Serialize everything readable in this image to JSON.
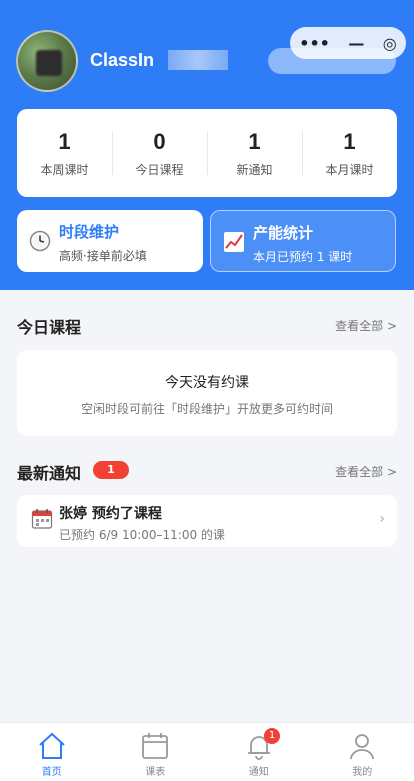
{
  "header": {
    "username": "ClassIn",
    "capsule": {
      "more_icon": "•••",
      "minimize_icon": "—",
      "close_icon": "◎"
    }
  },
  "stats": [
    {
      "value": "1",
      "label": "本周课时"
    },
    {
      "value": "0",
      "label": "今日课程"
    },
    {
      "value": "1",
      "label": "新通知"
    },
    {
      "value": "1",
      "label": "本月课时"
    }
  ],
  "cards": {
    "schedule": {
      "title": "时段维护",
      "subtitle": "高频·接单前必填",
      "icon": "clock-icon"
    },
    "stats": {
      "title": "产能统计",
      "subtitle": "本月已预约 1 课时",
      "icon": "chart-icon"
    }
  },
  "today": {
    "title": "今日课程",
    "view_all": "查看全部 >",
    "empty_title": "今天没有约课",
    "empty_hint": "空闲时段可前往「时段维护」开放更多可约时间"
  },
  "notices": {
    "title": "最新通知",
    "badge": "1",
    "view_all": "查看全部 >",
    "items": [
      {
        "name": "张婷 预约了课程",
        "detail": "已预约 6/9 10:00–11:00 的课",
        "icon": "calendar-icon"
      }
    ]
  },
  "tabbar": [
    {
      "label": "首页",
      "icon": "home-icon",
      "active": true
    },
    {
      "label": "课表",
      "icon": "calendar-icon"
    },
    {
      "label": "通知",
      "icon": "bell-icon",
      "badge": "1"
    },
    {
      "label": "我的",
      "icon": "user-icon"
    }
  ],
  "colors": {
    "primary": "#2f7df6",
    "badge": "#f04134",
    "background": "#f3f5f8"
  }
}
